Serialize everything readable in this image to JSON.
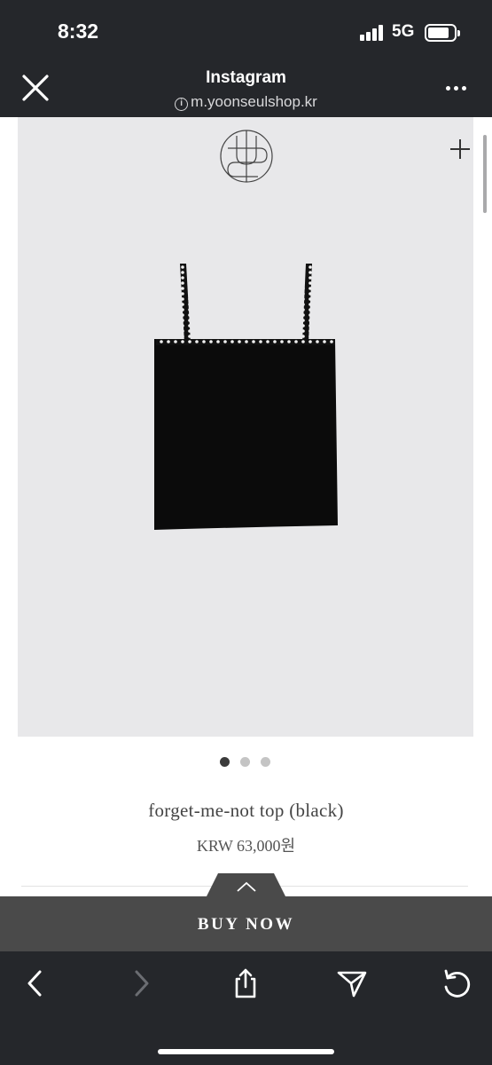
{
  "status_bar": {
    "time": "8:32",
    "network": "5G",
    "battery_level": 0.75
  },
  "browser": {
    "title": "Instagram",
    "url": "m.yoonseulshop.kr",
    "close_icon": "close-icon",
    "more_icon": "more-icon"
  },
  "product": {
    "name": "forget-me-not top (black)",
    "price": "KRW 63,000원",
    "image_count": 3,
    "active_image": 1,
    "image_background": "#e8e8ea",
    "garment_color": "#0b0b0b"
  },
  "buy": {
    "label": "BUY NOW",
    "bar_color": "#4a4a4a"
  },
  "toolbar": {
    "items": [
      "back-icon",
      "forward-icon",
      "share-icon",
      "send-icon",
      "reload-icon"
    ]
  },
  "colors": {
    "chrome": "#25272b",
    "text_dark": "#444444"
  }
}
